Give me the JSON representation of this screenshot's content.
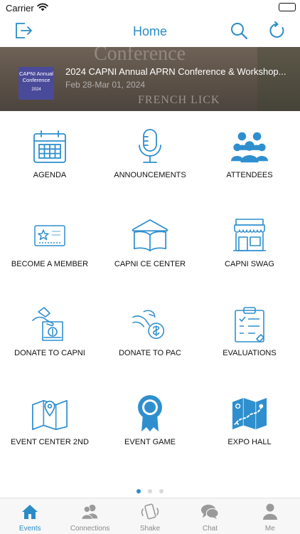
{
  "status": {
    "carrier": "Carrier"
  },
  "nav": {
    "title": "Home"
  },
  "banner": {
    "logo_line1": "CAPNI Annual Conference",
    "logo_line2": "2024",
    "title": "2024 CAPNI Annual APRN Conference & Workshop...",
    "date": "Feb 28-Mar 01, 2024",
    "bg_text_top": "Conference",
    "bg_text_bottom": "FRENCH LICK"
  },
  "tiles": [
    {
      "label": "AGENDA",
      "icon": "calendar-icon"
    },
    {
      "label": "ANNOUNCEMENTS",
      "icon": "microphone-icon"
    },
    {
      "label": "ATTENDEES",
      "icon": "people-icon"
    },
    {
      "label": "BECOME A MEMBER",
      "icon": "member-card-icon"
    },
    {
      "label": "CAPNI CE CENTER",
      "icon": "open-book-icon"
    },
    {
      "label": "CAPNI SWAG",
      "icon": "store-icon"
    },
    {
      "label": "DONATE TO CAPNI",
      "icon": "donate-box-icon"
    },
    {
      "label": "DONATE TO PAC",
      "icon": "donate-coin-icon"
    },
    {
      "label": "EVALUATIONS",
      "icon": "clipboard-icon"
    },
    {
      "label": "EVENT CENTER 2ND",
      "icon": "map-pin-icon"
    },
    {
      "label": "EVENT GAME",
      "icon": "award-ribbon-icon"
    },
    {
      "label": "EXPO HALL",
      "icon": "expo-map-icon"
    }
  ],
  "pager": {
    "pages": 3,
    "current": 1
  },
  "tabs": [
    {
      "label": "Events",
      "icon": "home-icon",
      "active": true
    },
    {
      "label": "Connections",
      "icon": "connections-icon",
      "active": false
    },
    {
      "label": "Shake",
      "icon": "shake-phone-icon",
      "active": false
    },
    {
      "label": "Chat",
      "icon": "chat-icon",
      "active": false
    },
    {
      "label": "Me",
      "icon": "person-icon",
      "active": false
    }
  ],
  "colors": {
    "accent": "#2a8cc7",
    "icon_blue": "#2f8fce",
    "tab_inactive": "#8a8a8a"
  }
}
